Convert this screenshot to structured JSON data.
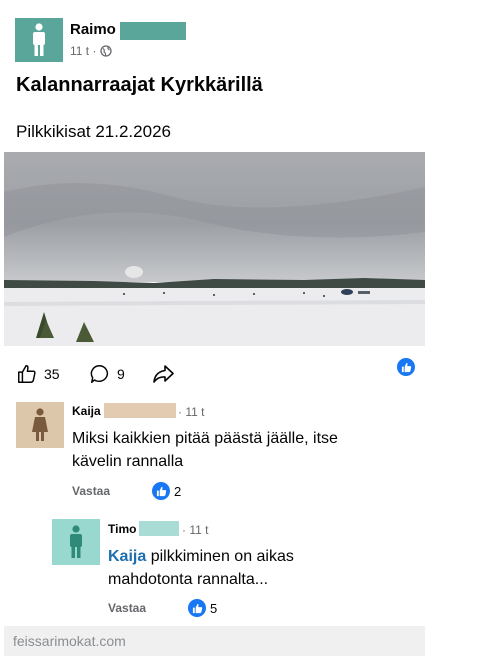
{
  "colors": {
    "post_avatar": "#5aa69a",
    "kaija_avatar": "#dcc7aa",
    "timo_avatar": "#98d8ce",
    "redact_green": "#5aa69a",
    "redact_tan": "#e2cbb0",
    "redact_mint": "#a9dcd4",
    "like_blue": "#1877f2",
    "mention_blue": "#1d6fb0"
  },
  "post": {
    "author": "Raimo",
    "meta_time": "11 t ·",
    "audience_icon": "globe-icon",
    "title": "Kalannarraajat Kyrkkärillä",
    "subtitle": "Pilkkikisat 21.2.2026",
    "image_alt": "frozen-lake-photo"
  },
  "actions": {
    "likes": "35",
    "comments": "9"
  },
  "comments": [
    {
      "author": "Kaija",
      "time": "· 11 t",
      "text": "Miksi kaikkien pitää päästä jäälle, itse kävelin rannalla",
      "reply_label": "Vastaa",
      "likes": "2"
    },
    {
      "author": "Timo",
      "time": "· 11 t",
      "mention": "Kaija",
      "text": "pilkkiminen on aikas mahdotonta rannalta...",
      "reply_label": "Vastaa",
      "likes": "5"
    }
  ],
  "watermark": "feissarimokat.com"
}
